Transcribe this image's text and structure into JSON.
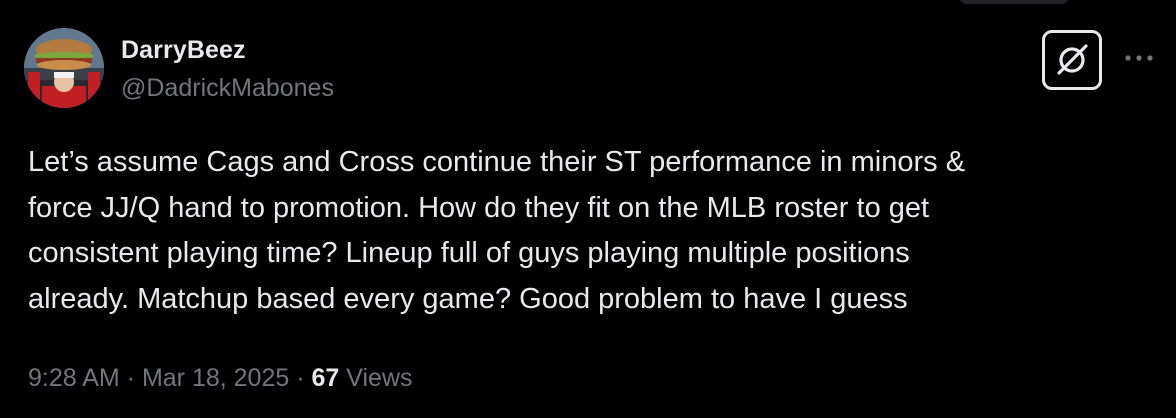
{
  "author": {
    "display_name": "DarryBeez",
    "handle": "@DadrickMabones",
    "avatar_icon": "profile-photo"
  },
  "actions": {
    "grok_icon": "grok-icon",
    "more_icon": "more-horizontal-icon"
  },
  "tweet": {
    "text": "Let’s assume Cags and Cross continue their ST performance in minors &\nforce JJ/Q hand to promotion. How do they fit on the MLB roster to get\nconsistent playing time? Lineup full of guys playing multiple positions\nalready. Matchup based every game? Good problem to have I guess"
  },
  "meta": {
    "time": "9:28 AM",
    "separator": " · ",
    "date": "Mar 18, 2025",
    "views_count": "67",
    "views_label": " Views"
  },
  "colors": {
    "background": "#000000",
    "primary_text": "#e7e9ea",
    "secondary_text": "#71767b"
  }
}
